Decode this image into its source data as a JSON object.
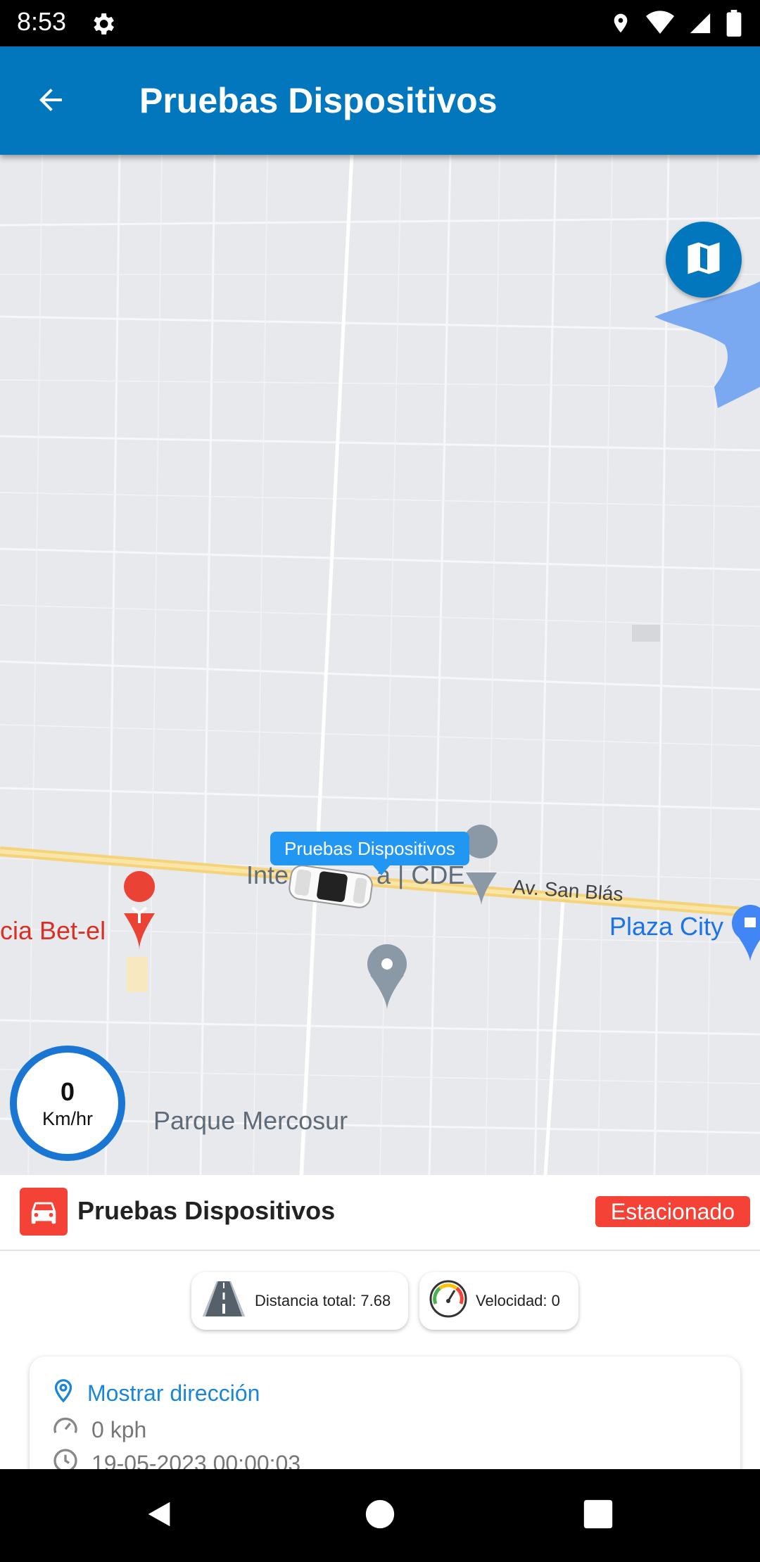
{
  "status_bar": {
    "time": "8:53",
    "icons": [
      "gear-icon",
      "location-icon",
      "wifi-icon",
      "signal-icon",
      "battery-icon"
    ]
  },
  "app_bar": {
    "title": "Pruebas Dispositivos",
    "back_icon": "arrow-back-icon",
    "color": "#0277bd"
  },
  "map": {
    "vehicle_tooltip": "Pruebas Dispositivos",
    "labels": {
      "poi_intercity": "Inte",
      "poi_intercity_rest": "a | CDE",
      "street": "Av. San Blás",
      "poi_bet_el": "cia Bet-el",
      "plaza": "Plaza City",
      "park": "Parque Mercosur"
    },
    "map_type_icon": "map-icon"
  },
  "speed_gauge": {
    "value": "0",
    "unit": "Km/hr"
  },
  "vehicle_panel": {
    "name": "Pruebas Dispositivos",
    "status": "Estacionado",
    "status_color": "#f44336",
    "icon": "car-icon",
    "chips": {
      "distance": "Distancia total: 7.68",
      "speed": "Velocidad: 0"
    },
    "info": {
      "address_link": "Mostrar dirección",
      "speed": "0 kph",
      "timestamp": "19-05-2023 00:00:03"
    }
  },
  "nav_bar": {
    "icons": [
      "back-triangle-icon",
      "home-circle-icon",
      "recents-square-icon"
    ]
  }
}
